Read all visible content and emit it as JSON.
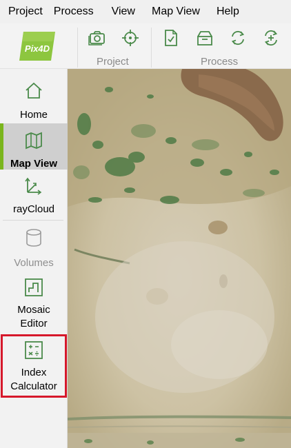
{
  "menu": [
    "Project",
    "Process",
    "View",
    "Map View",
    "Help"
  ],
  "toolbar": {
    "logo_text": "Pix4D",
    "project_label": "Project",
    "process_label": "Process"
  },
  "sidebar": {
    "items": [
      {
        "label": "Home",
        "icon": "house-icon"
      },
      {
        "label": "Map View",
        "icon": "map-icon",
        "active": true
      },
      {
        "label": "rayCloud",
        "icon": "raycloud-icon"
      },
      {
        "label": "Volumes",
        "icon": "cylinder-icon",
        "disabled": true
      },
      {
        "label": "Mosaic\nEditor",
        "icon": "mosaic-editor-icon"
      },
      {
        "label": "Index\nCalculator",
        "icon": "index-calculator-icon"
      }
    ]
  },
  "colors": {
    "accent": "#7ab51d",
    "icon": "#4a8a4a",
    "highlight": "#d6182b"
  }
}
